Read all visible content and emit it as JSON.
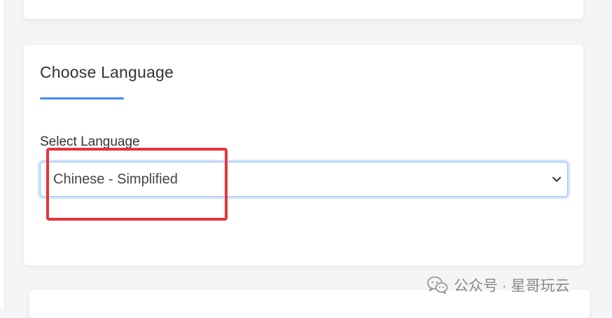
{
  "language_card": {
    "title": "Choose Language",
    "field_label": "Select Language",
    "selected_language": "Chinese - Simplified"
  },
  "watermark": {
    "text": "公众号 · 星哥玩云",
    "icon": "wechat-icon"
  },
  "colors": {
    "accent": "#3f8ef0",
    "highlight": "#e8333a",
    "background": "#f4f5f7",
    "card": "#ffffff"
  }
}
